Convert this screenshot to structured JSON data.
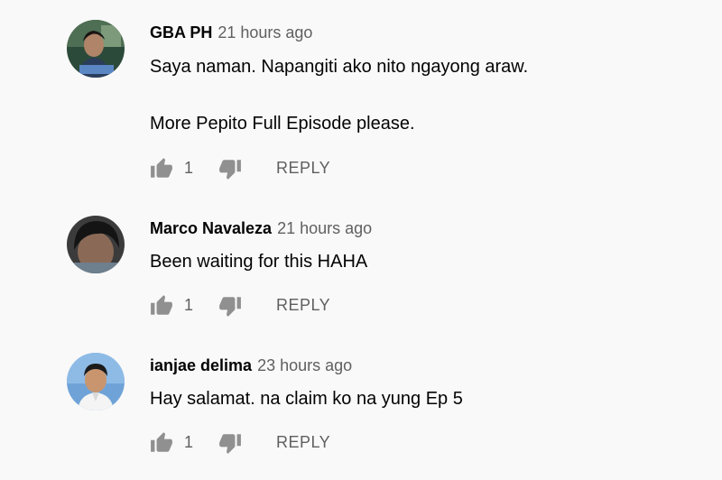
{
  "comments": [
    {
      "author": "GBA PH",
      "time": "21 hours ago",
      "lines": [
        "Saya naman. Napangiti ako nito ngayong araw.",
        "More Pepito Full Episode please."
      ],
      "likes": "1",
      "reply_label": "REPLY"
    },
    {
      "author": "Marco Navaleza",
      "time": "21 hours ago",
      "lines": [
        "Been waiting for this HAHA"
      ],
      "likes": "1",
      "reply_label": "REPLY"
    },
    {
      "author": "ianjae delima",
      "time": "23 hours ago",
      "lines": [
        "Hay salamat. na claim ko na yung Ep 5"
      ],
      "likes": "1",
      "reply_label": "REPLY"
    }
  ],
  "colors": {
    "background": "#f9f9f9",
    "text": "#030303",
    "secondary": "#606060"
  },
  "icons": {
    "like": "thumb-up-icon",
    "dislike": "thumb-down-icon"
  }
}
